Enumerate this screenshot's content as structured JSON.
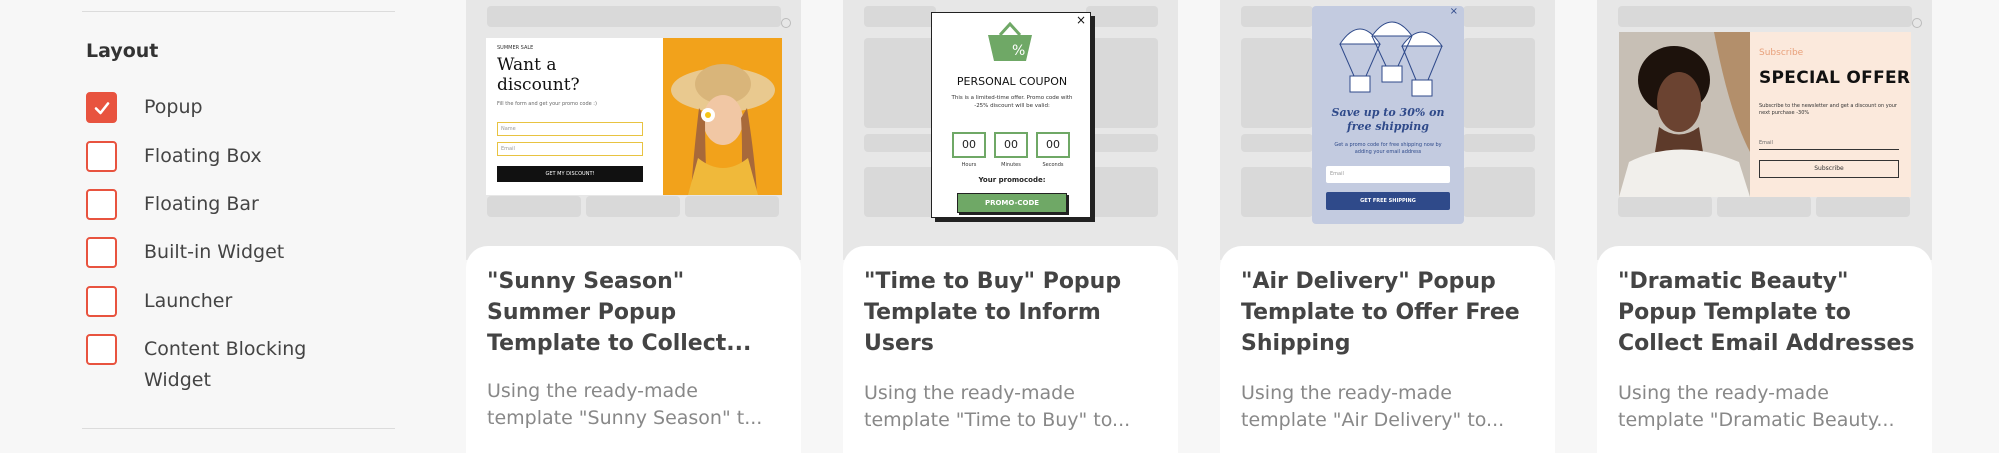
{
  "sidebar": {
    "title": "Layout",
    "options": [
      {
        "label": "Popup",
        "checked": true
      },
      {
        "label": "Floating Box",
        "checked": false
      },
      {
        "label": "Floating Bar",
        "checked": false
      },
      {
        "label": "Built-in Widget",
        "checked": false
      },
      {
        "label": "Launcher",
        "checked": false
      },
      {
        "label": "Content Blocking Widget",
        "checked": false
      }
    ]
  },
  "colors": {
    "accent": "#e8533f",
    "green": "#6fa866",
    "navy": "#2f4a8a"
  },
  "cards": [
    {
      "title": "\"Sunny Season\" Summer Popup Template to Collect...",
      "desc_line1": "Using the ready-made",
      "desc_line2": "template \"Sunny Season\" t...",
      "popup": {
        "tag": "SUMMER SALE",
        "headline": "Want a discount?",
        "sub": "Fill the form and get your promo code :)",
        "name_placeholder": "Name",
        "email_placeholder": "Email",
        "button": "GET MY DISCOUNT!"
      }
    },
    {
      "title": "\"Time to Buy\" Popup Template to Inform Users",
      "desc_line1": "Using the ready-made",
      "desc_line2": "template \"Time to Buy\" to...",
      "popup": {
        "heading": "PERSONAL COUPON",
        "text": "This is a limited-time offer. Promo code with -25% discount will be valid:",
        "hours": "00",
        "minutes": "00",
        "seconds": "00",
        "hours_label": "Hours",
        "minutes_label": "Minutes",
        "seconds_label": "Seconds",
        "promo_label": "Your promocode:",
        "promo_code": "PROMO-CODE"
      }
    },
    {
      "title": "\"Air Delivery\" Popup Template to Offer Free Shipping",
      "desc_line1": "Using the ready-made",
      "desc_line2": "template \"Air Delivery\" to...",
      "popup": {
        "headline": "Save up to 30% on free shipping",
        "sub": "Get a promo code for free shipping now by adding your email address",
        "email_placeholder": "Email",
        "button": "GET FREE SHIPPING"
      }
    },
    {
      "title": "\"Dramatic Beauty\" Popup Template to Collect Email Addresses",
      "desc_line1": "Using the ready-made",
      "desc_line2": "template \"Dramatic Beauty...",
      "popup": {
        "kicker": "Subscribe",
        "headline": "SPECIAL OFFER",
        "sub": "Subscribe to the newsletter and get a discount on your next purchase -30%",
        "email_placeholder": "Email",
        "button": "Subscribe"
      }
    }
  ]
}
